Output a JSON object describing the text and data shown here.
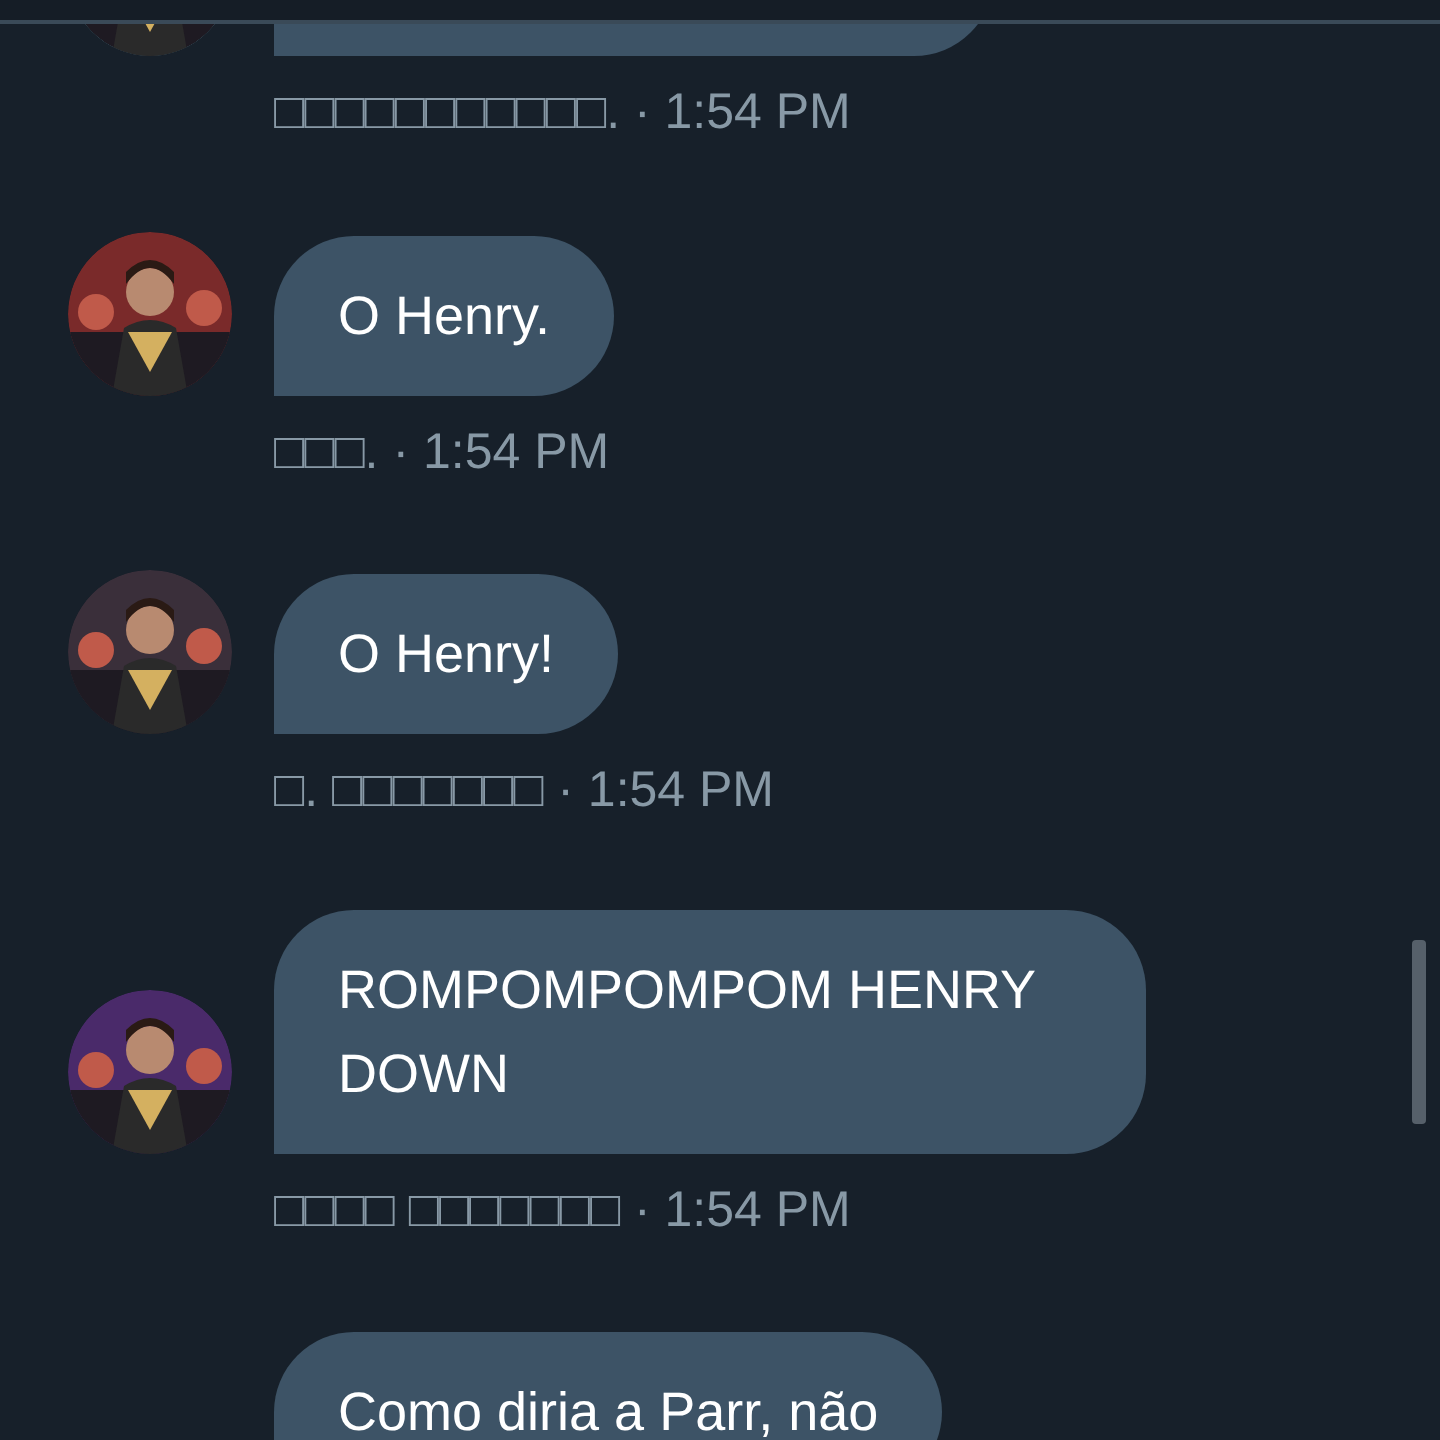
{
  "messages": [
    {
      "sender": "□□□□□□□□□□□.",
      "separator": "·",
      "time": "1:54 PM"
    },
    {
      "text": "O Henry.",
      "sender": "□□□.",
      "separator": "·",
      "time": "1:54 PM"
    },
    {
      "text": "O Henry!",
      "sender": "□. □□□□□□□",
      "separator": "·",
      "time": "1:54 PM"
    },
    {
      "text": "ROMPOMPOMPOM HENRY DOWN",
      "sender": "□□□□ □□□□□□□",
      "separator": "·",
      "time": "1:54 PM"
    },
    {
      "text": "Como diria a Parr, não"
    }
  ]
}
